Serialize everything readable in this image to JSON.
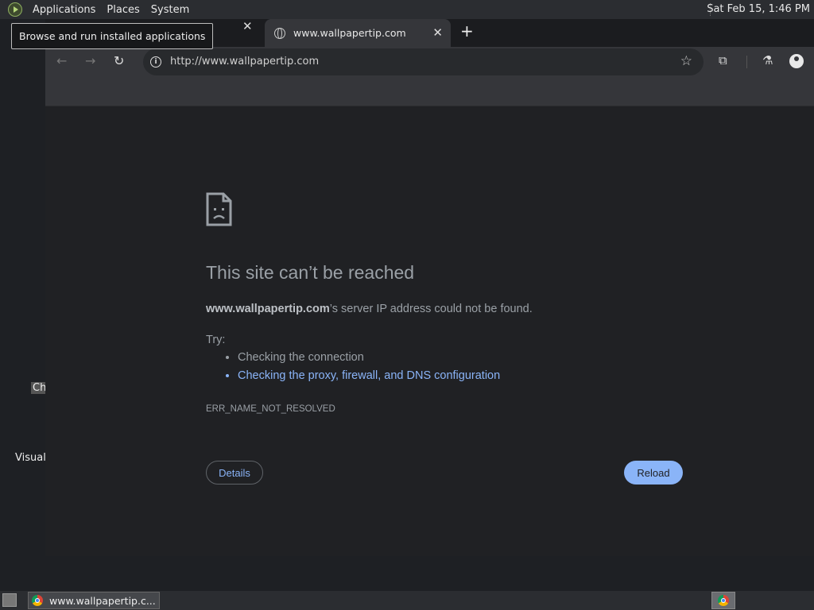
{
  "top_panel": {
    "menus": [
      "Applications",
      "Places",
      "System"
    ],
    "clock": "Sat Feb 15,  1:46 PM"
  },
  "tooltip": "Browse and run installed applications",
  "desktop": {
    "labels": [
      "Ch",
      "Visual"
    ]
  },
  "browser": {
    "tab_title": "www.wallpapertip.com",
    "new_tab_symbol": "+",
    "url": "http://www.wallpapertip.com",
    "error": {
      "title": "This site can’t be reached",
      "host": "www.wallpapertip.com",
      "description_suffix": "’s server IP address could not be found.",
      "try_label": "Try:",
      "suggestions": [
        "Checking the connection",
        "Checking the proxy, firewall, and DNS configuration"
      ],
      "code": "ERR_NAME_NOT_RESOLVED",
      "details_button": "Details",
      "reload_button": "Reload"
    }
  },
  "taskbar": {
    "item_label": "www.wallpapertip.c..."
  },
  "colors": {
    "link": "#8ab4f8",
    "reload_bg": "#8ab4f8"
  }
}
